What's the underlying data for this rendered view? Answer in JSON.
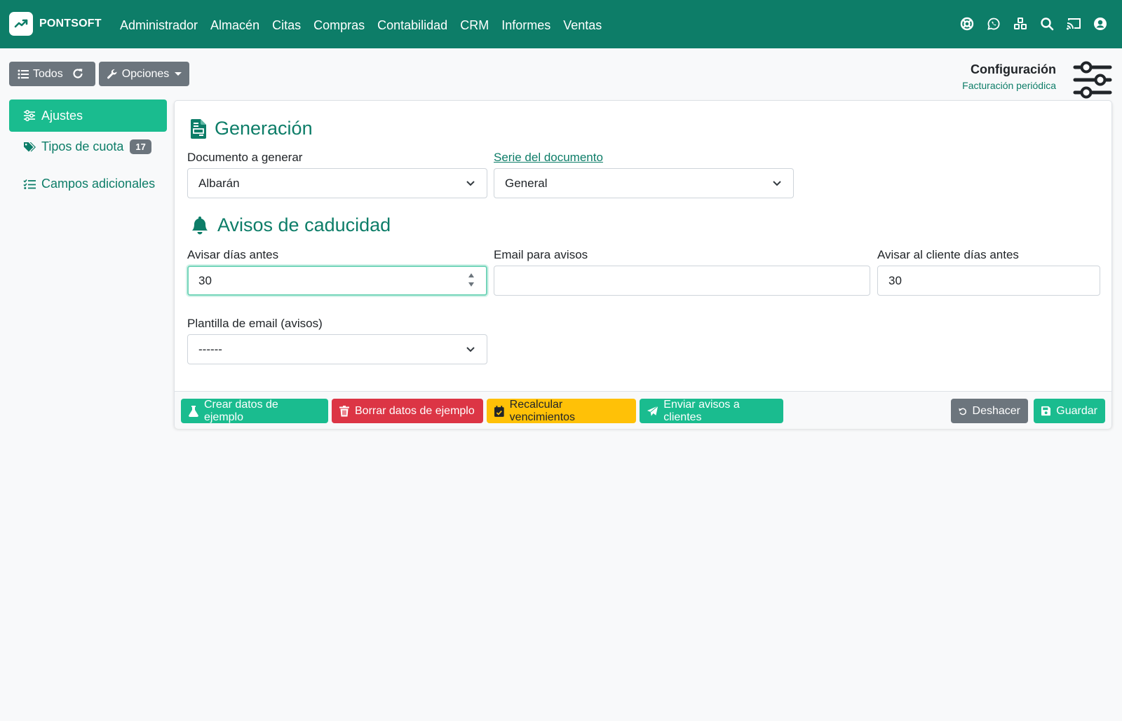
{
  "navbar": {
    "brand": "PONTSOFT",
    "menu": [
      "Administrador",
      "Almacén",
      "Citas",
      "Compras",
      "Contabilidad",
      "CRM",
      "Informes",
      "Ventas"
    ],
    "icons": [
      "lifebuoy-icon",
      "whatsapp-icon",
      "cubes-icon",
      "search-icon",
      "cast-icon",
      "user-circle-icon"
    ]
  },
  "toolbar": {
    "all_label": "Todos",
    "options_label": "Opciones"
  },
  "page_header": {
    "title": "Configuración",
    "subtitle": "Facturación periódica"
  },
  "sidebar": {
    "items": [
      {
        "label": "Ajustes",
        "icon": "sliders-icon",
        "active": true
      },
      {
        "label": "Tipos de cuota",
        "icon": "tags-icon",
        "badge": "17"
      },
      {
        "label": "Campos adicionales",
        "icon": "list-check-icon"
      }
    ]
  },
  "generation": {
    "title": "Generación",
    "document_label": "Documento a generar",
    "document_value": "Albarán",
    "series_label": "Serie del documento",
    "series_value": "General"
  },
  "expiry": {
    "title": "Avisos de caducidad",
    "days_before_label": "Avisar días antes",
    "days_before_value": "30",
    "email_label": "Email para avisos",
    "email_value": "",
    "client_days_label": "Avisar al cliente días antes",
    "client_days_value": "30",
    "template_label": "Plantilla de email (avisos)",
    "template_value": "------"
  },
  "footer": {
    "create_sample": "Crear datos de ejemplo",
    "delete_sample": "Borrar datos de ejemplo",
    "recalculate": "Recalcular vencimientos",
    "send_notices": "Enviar avisos a clientes",
    "undo": "Deshacer",
    "save": "Guardar"
  },
  "colors": {
    "primary": "#0d7d68",
    "success": "#1abc8f",
    "danger": "#dc3545",
    "warning": "#ffc107",
    "secondary": "#6c757d"
  }
}
